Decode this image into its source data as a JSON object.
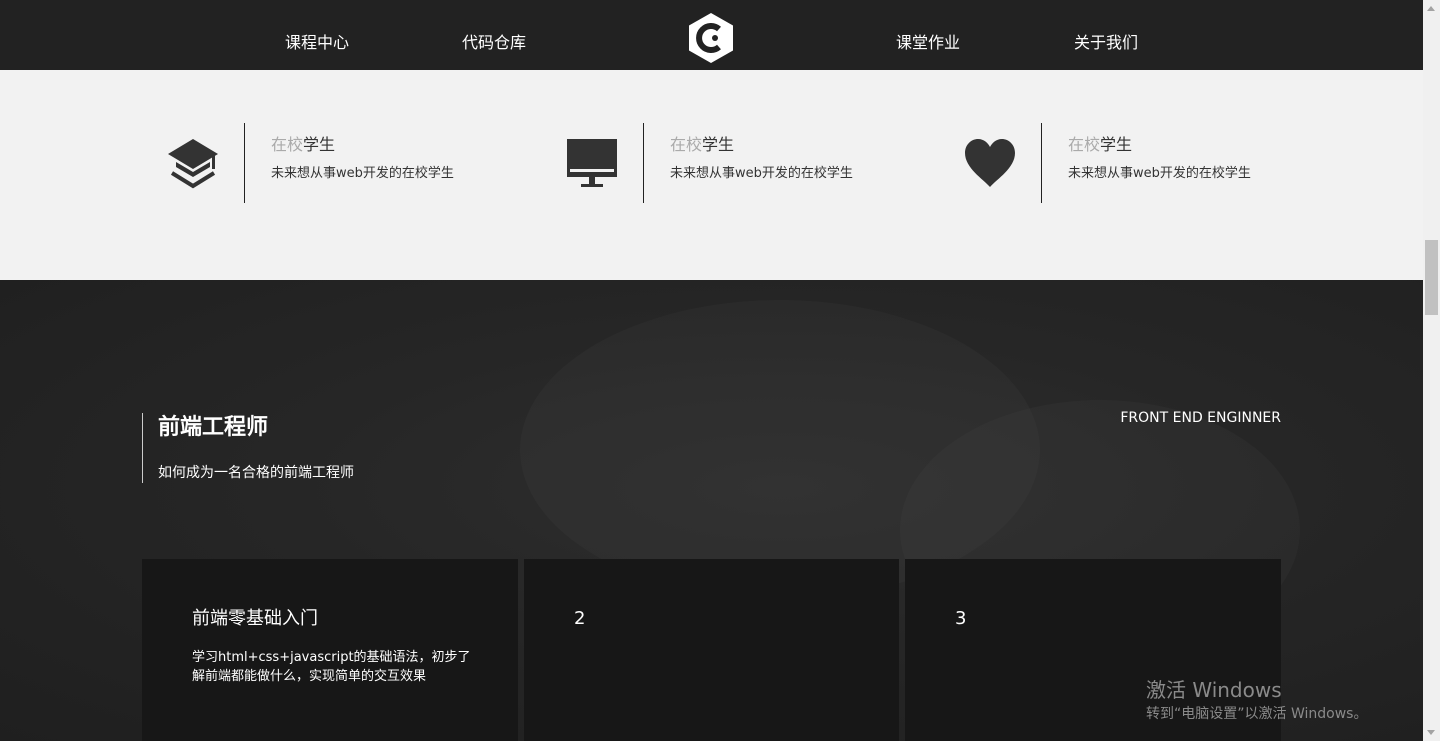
{
  "nav": {
    "items": [
      "课程中心",
      "代码仓库",
      "课堂作业",
      "关于我们"
    ],
    "logo_icon": "hexagon-c-logo-icon"
  },
  "features": [
    {
      "icon": "graduation-cap-icon",
      "title_dim": "在校",
      "title_main": "学生",
      "desc": "未来想从事web开发的在校学生"
    },
    {
      "icon": "monitor-icon",
      "title_dim": "在校",
      "title_main": "学生",
      "desc": "未来想从事web开发的在校学生"
    },
    {
      "icon": "heart-icon",
      "title_dim": "在校",
      "title_main": "学生",
      "desc": "未来想从事web开发的在校学生"
    }
  ],
  "section": {
    "title": "前端工程师",
    "subtitle": "如何成为一名合格的前端工程师",
    "english": "FRONT END ENGINNER"
  },
  "cards": [
    {
      "title": "前端零基础入门",
      "desc": "学习html+css+javascript的基础语法，初步了解前端都能做什么，实现简单的交互效果"
    },
    {
      "title": "2",
      "desc": ""
    },
    {
      "title": "3",
      "desc": ""
    }
  ],
  "watermark": {
    "line1": "激活 Windows",
    "line2": "转到“电脑设置”以激活 Windows。"
  },
  "colors": {
    "nav_bg": "#222222",
    "feature_bg": "#f2f2f2",
    "card_bg": "#171717"
  }
}
